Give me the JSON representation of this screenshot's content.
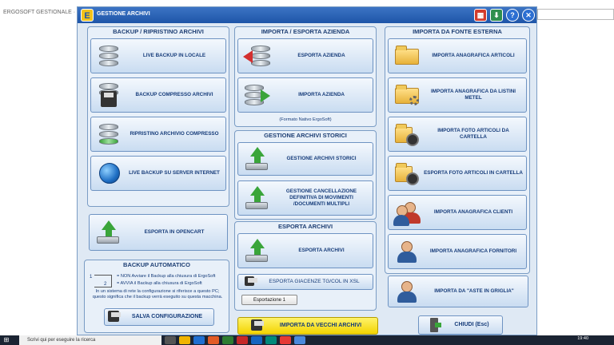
{
  "background_window": {
    "title": "ERGOSOFT GESTIONALE  ·  \"II S"
  },
  "app": {
    "title": "GESTIONE ARCHIVI",
    "logo_letter": "E"
  },
  "titlebar_buttons": [
    {
      "icon": "calculator-icon",
      "color": "#d33b2c",
      "glyph": "▦"
    },
    {
      "icon": "download-icon",
      "color": "#2f8f4f",
      "glyph": "⬇"
    },
    {
      "icon": "help-icon",
      "color": "#2d6fd2",
      "glyph": "?"
    },
    {
      "icon": "close-icon",
      "color": "#2d6fd2",
      "glyph": "✕"
    }
  ],
  "panels": {
    "backup": {
      "title": "BACKUP / RIPRISTINO ARCHIVI",
      "buttons": [
        "LIVE BACKUP IN LOCALE",
        "BACKUP COMPRESSO ARCHIVI",
        "RIPRISTINO ARCHIVIO COMPRESSO",
        "LIVE BACKUP SU SERVER INTERNET"
      ]
    },
    "esporta_opencart": {
      "label": "ESPORTA IN OPENCART"
    },
    "backup_auto": {
      "title": "BACKUP AUTOMATICO",
      "legend1": "= NON Avviare il Backup alla chiusura di ErgoSoft",
      "legend2": "= AVVIA il Backup alla chiusura di ErgoSoft",
      "note": "In un sistema di rete la configurazione si riferisce a questo PC; questo significa che il backup verrà eseguito su questa macchina.",
      "save_label": "SALVA CONFIGURAZIONE"
    },
    "importa_esporta": {
      "title": "IMPORTA / ESPORTA AZIENDA",
      "buttons": [
        "ESPORTA AZIENDA",
        "IMPORTA AZIENDA"
      ],
      "note": "(Formato Nativo ErgoSoft)"
    },
    "storici": {
      "title": "GESTIONE ARCHIVI STORICI",
      "buttons": [
        "GESTIONE ARCHIVI STORICI",
        "GESTIONE CANCELLAZIONE DEFINITIVA DI MOVIMENTI /DOCUMENTI MULTIPLI"
      ]
    },
    "esporta_archivi": {
      "title": "ESPORTA ARCHIVI",
      "button": "ESPORTA ARCHIVI",
      "giacenze_label": "ESPORTA GIACENZE TG/COL IN XSL",
      "esportazione_label": "Esportazione 1"
    },
    "fonte_esterna": {
      "title": "IMPORTA DA FONTE ESTERNA",
      "buttons": [
        "IMPORTA ANAGRAFICA ARTICOLI",
        "IMPORTA ANAGRAFICA DA LISTINI METEL",
        "IMPORTA FOTO ARTICOLI DA CARTELLA",
        "ESPORTA FOTO ARTICOLI IN CARTELLA",
        "IMPORTA ANAGRAFICA CLIENTI",
        "IMPORTA ANAGRAFICA FORNITORI"
      ]
    },
    "aste": {
      "label": "IMPORTA DA \"ASTE IN GRIGLIA\""
    }
  },
  "bottom": {
    "importa_vecchi": "IMPORTA DA VECCHI ARCHIVI",
    "chiudi": "CHIUDI  (Esc)"
  },
  "taskbar": {
    "search_placeholder": "Scrivi qui per eseguire la ricerca",
    "time": "19:40"
  }
}
